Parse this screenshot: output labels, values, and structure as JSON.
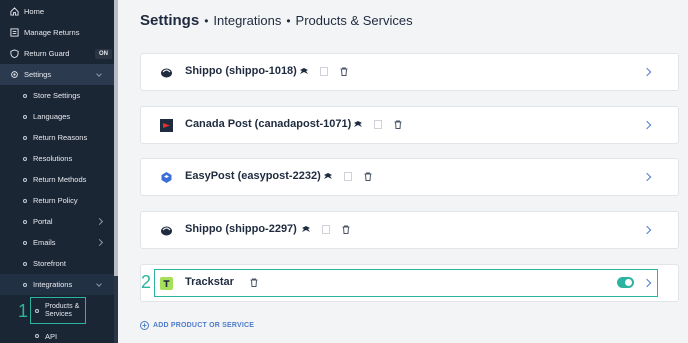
{
  "sidebar": {
    "items": [
      {
        "label": "Home",
        "icon": "home-icon"
      },
      {
        "label": "Manage Returns",
        "icon": "returns-icon"
      },
      {
        "label": "Return Guard",
        "icon": "shield-icon",
        "badge": "ON"
      },
      {
        "label": "Settings",
        "icon": "gear-icon"
      }
    ],
    "settings_sub": [
      "Store Settings",
      "Languages",
      "Return Reasons",
      "Resolutions",
      "Return Methods",
      "Return Policy",
      "Portal",
      "Emails",
      "Storefront",
      "Integrations"
    ],
    "integrations_sub": [
      "Products & Services",
      "API"
    ]
  },
  "breadcrumb": {
    "root": "Settings",
    "sep": "•",
    "level1": "Integrations",
    "level2": "Products & Services"
  },
  "cards": [
    {
      "name": "Shippo (shippo-1018)",
      "logo": "shippo-logo"
    },
    {
      "name": "Canada Post (canadapost-1071)",
      "logo": "canadapost-logo"
    },
    {
      "name": "EasyPost (easypost-2232)",
      "logo": "easypost-logo"
    },
    {
      "name": "Shippo (shippo-2297)",
      "logo": "shippo-logo"
    },
    {
      "name": "Trackstar",
      "logo": "trackstar-logo",
      "enabled": true
    }
  ],
  "add_label": "ADD PRODUCT OR SERVICE",
  "annotations": {
    "one": "1",
    "two": "2"
  },
  "colors": {
    "sidebar_bg": "#1b2635",
    "accent": "#2bb5a0",
    "link": "#4e7bc9",
    "text_dark": "#1f2b3e"
  }
}
